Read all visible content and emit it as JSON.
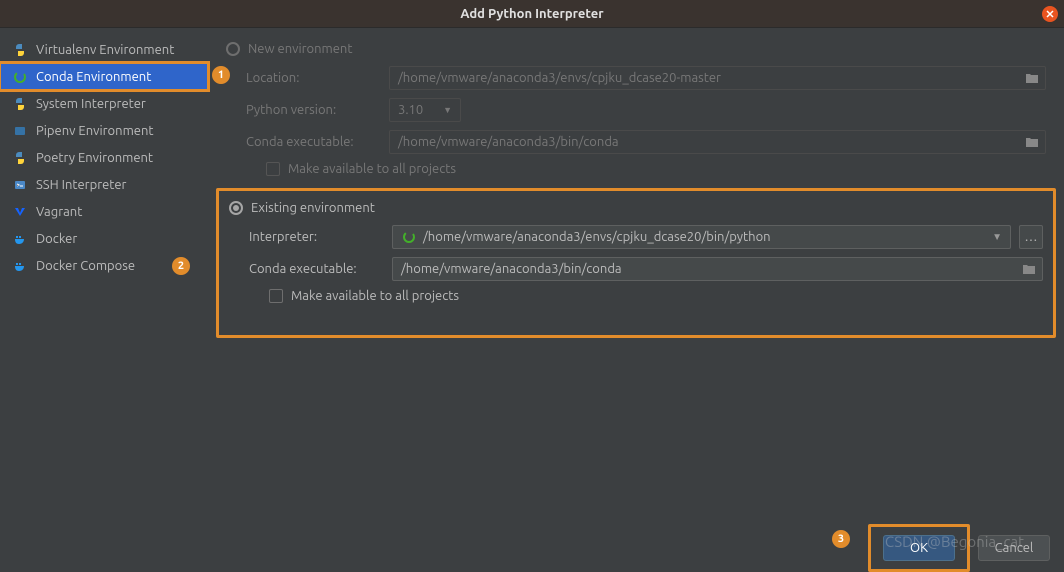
{
  "title": "Add Python Interpreter",
  "sidebar": {
    "items": [
      {
        "label": "Virtualenv Environment"
      },
      {
        "label": "Conda Environment"
      },
      {
        "label": "System Interpreter"
      },
      {
        "label": "Pipenv Environment"
      },
      {
        "label": "Poetry Environment"
      },
      {
        "label": "SSH Interpreter"
      },
      {
        "label": "Vagrant"
      },
      {
        "label": "Docker"
      },
      {
        "label": "Docker Compose"
      }
    ]
  },
  "new_env": {
    "radio_label": "New environment",
    "location_label": "Location:",
    "location_value": "/home/vmware/anaconda3/envs/cpjku_dcase20-master",
    "python_version_label": "Python version:",
    "python_version_value": "3.10",
    "conda_exec_label": "Conda executable:",
    "conda_exec_value": "/home/vmware/anaconda3/bin/conda",
    "make_available_label": "Make available to all projects"
  },
  "existing_env": {
    "radio_label": "Existing environment",
    "interpreter_label": "Interpreter:",
    "interpreter_value": "/home/vmware/anaconda3/envs/cpjku_dcase20/bin/python",
    "conda_exec_label": "Conda executable:",
    "conda_exec_value": "/home/vmware/anaconda3/bin/conda",
    "make_available_label": "Make available to all projects"
  },
  "buttons": {
    "ok": "OK",
    "cancel": "Cancel"
  },
  "annotations": {
    "b1": "1",
    "b2": "2",
    "b3": "3"
  },
  "watermark": "CSDN @Begonia_cat"
}
